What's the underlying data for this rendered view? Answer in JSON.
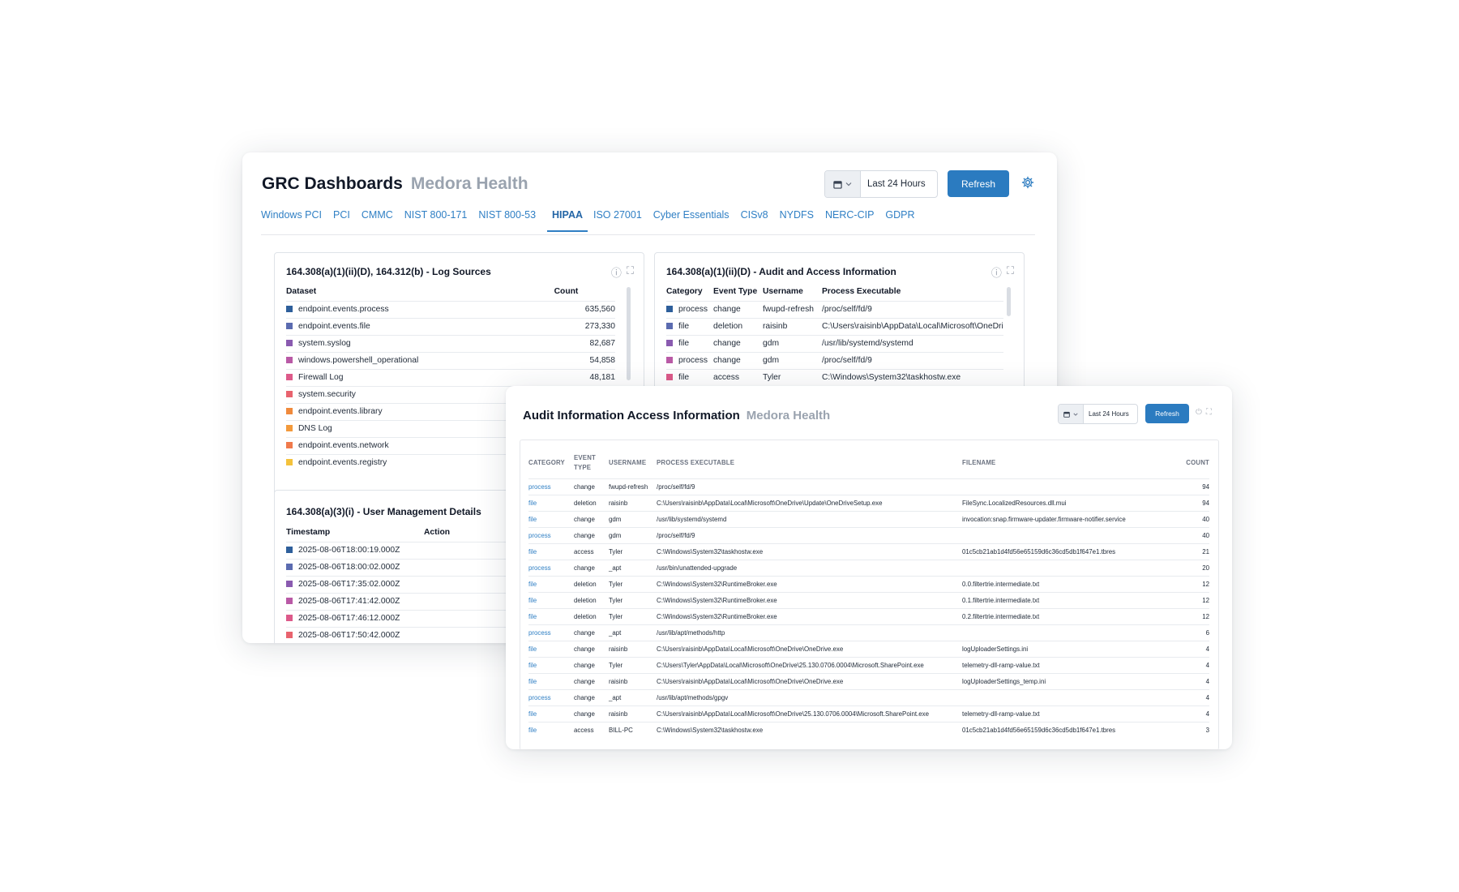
{
  "dashboard": {
    "title": "GRC Dashboards",
    "org": "Medora Health",
    "date_range": "Last 24 Hours",
    "refresh_label": "Refresh",
    "tabs": [
      "Windows PCI",
      "PCI",
      "CMMC",
      "NIST 800-171",
      "NIST 800-53",
      "HIPAA",
      "ISO 27001",
      "Cyber Essentials",
      "CISv8",
      "NYDFS",
      "NERC-CIP",
      "GDPR"
    ],
    "active_tab": "HIPAA",
    "panels": {
      "log_sources": {
        "title": "164.308(a)(1)(ii)(D), 164.312(b) - Log Sources",
        "headers": [
          "Dataset",
          "Count"
        ],
        "rows": [
          {
            "dataset": "endpoint.events.process",
            "count": "635,560",
            "color": "#2e5f9b"
          },
          {
            "dataset": "endpoint.events.file",
            "count": "273,330",
            "color": "#5b6bb0"
          },
          {
            "dataset": "system.syslog",
            "count": "82,687",
            "color": "#8a5bb0"
          },
          {
            "dataset": "windows.powershell_operational",
            "count": "54,858",
            "color": "#b95aa6"
          },
          {
            "dataset": "Firewall Log",
            "count": "48,181",
            "color": "#dd5a8a"
          },
          {
            "dataset": "system.security",
            "count": "",
            "color": "#e8636e"
          },
          {
            "dataset": "endpoint.events.library",
            "count": "",
            "color": "#f08a3c"
          },
          {
            "dataset": "DNS Log",
            "count": "",
            "color": "#f39a3c"
          },
          {
            "dataset": "endpoint.events.network",
            "count": "",
            "color": "#f07a4c"
          },
          {
            "dataset": "endpoint.events.registry",
            "count": "",
            "color": "#f4c23c"
          }
        ]
      },
      "audit_access": {
        "title": "164.308(a)(1)(ii)(D) - Audit and Access Information",
        "headers": [
          "Category",
          "Event Type",
          "Username",
          "Process Executable"
        ],
        "rows": [
          {
            "category": "process",
            "event_type": "change",
            "username": "fwupd-refresh",
            "process": "/proc/self/fd/9",
            "color": "#2e5f9b"
          },
          {
            "category": "file",
            "event_type": "deletion",
            "username": "raisinb",
            "process": "C:\\Users\\raisinb\\AppData\\Local\\Microsoft\\OneDri",
            "color": "#5b6bb0"
          },
          {
            "category": "file",
            "event_type": "change",
            "username": "gdm",
            "process": "/usr/lib/systemd/systemd",
            "color": "#8a5bb0"
          },
          {
            "category": "process",
            "event_type": "change",
            "username": "gdm",
            "process": "/proc/self/fd/9",
            "color": "#b95aa6"
          },
          {
            "category": "file",
            "event_type": "access",
            "username": "Tyler",
            "process": "C:\\Windows\\System32\\taskhostw.exe",
            "color": "#dd5a8a"
          }
        ]
      },
      "user_mgmt": {
        "title": "164.308(a)(3)(i) - User Management Details",
        "headers": [
          "Timestamp",
          "Action"
        ],
        "rows": [
          {
            "timestamp": "2025-08-06T18:00:19.000Z",
            "color": "#2e5f9b"
          },
          {
            "timestamp": "2025-08-06T18:00:02.000Z",
            "color": "#5b6bb0"
          },
          {
            "timestamp": "2025-08-06T17:35:02.000Z",
            "color": "#8a5bb0"
          },
          {
            "timestamp": "2025-08-06T17:41:42.000Z",
            "color": "#b95aa6"
          },
          {
            "timestamp": "2025-08-06T17:46:12.000Z",
            "color": "#dd5a8a"
          },
          {
            "timestamp": "2025-08-06T17:50:42.000Z",
            "color": "#e8636e"
          }
        ]
      }
    }
  },
  "detail": {
    "title": "Audit Information Access Information",
    "org": "Medora Health",
    "date_range": "Last 24 Hours",
    "refresh_label": "Refresh",
    "headers": [
      "CATEGORY",
      "EVENT TYPE",
      "USERNAME",
      "PROCESS EXECUTABLE",
      "FILENAME",
      "COUNT"
    ],
    "rows": [
      {
        "category": "process",
        "event_type": "change",
        "username": "fwupd-refresh",
        "process": "/proc/self/fd/9",
        "filename": "",
        "count": "94"
      },
      {
        "category": "file",
        "event_type": "deletion",
        "username": "raisinb",
        "process": "C:\\Users\\raisinb\\AppData\\Local\\Microsoft\\OneDrive\\Update\\OneDriveSetup.exe",
        "filename": "FileSync.LocalizedResources.dll.mui",
        "count": "94"
      },
      {
        "category": "file",
        "event_type": "change",
        "username": "gdm",
        "process": "/usr/lib/systemd/systemd",
        "filename": "invocation:snap.firmware-updater.firmware-notifier.service",
        "count": "40"
      },
      {
        "category": "process",
        "event_type": "change",
        "username": "gdm",
        "process": "/proc/self/fd/9",
        "filename": "",
        "count": "40"
      },
      {
        "category": "file",
        "event_type": "access",
        "username": "Tyler",
        "process": "C:\\Windows\\System32\\taskhostw.exe",
        "filename": "01c5cb21ab1d4fd56e65159d6c36cd5db1f647e1.tbres",
        "count": "21"
      },
      {
        "category": "process",
        "event_type": "change",
        "username": "_apt",
        "process": "/usr/bin/unattended-upgrade",
        "filename": "",
        "count": "20"
      },
      {
        "category": "file",
        "event_type": "deletion",
        "username": "Tyler",
        "process": "C:\\Windows\\System32\\RuntimeBroker.exe",
        "filename": "0.0.filtertrie.intermediate.txt",
        "count": "12"
      },
      {
        "category": "file",
        "event_type": "deletion",
        "username": "Tyler",
        "process": "C:\\Windows\\System32\\RuntimeBroker.exe",
        "filename": "0.1.filtertrie.intermediate.txt",
        "count": "12"
      },
      {
        "category": "file",
        "event_type": "deletion",
        "username": "Tyler",
        "process": "C:\\Windows\\System32\\RuntimeBroker.exe",
        "filename": "0.2.filtertrie.intermediate.txt",
        "count": "12"
      },
      {
        "category": "process",
        "event_type": "change",
        "username": "_apt",
        "process": "/usr/lib/apt/methods/http",
        "filename": "",
        "count": "6"
      },
      {
        "category": "file",
        "event_type": "change",
        "username": "raisinb",
        "process": "C:\\Users\\raisinb\\AppData\\Local\\Microsoft\\OneDrive\\OneDrive.exe",
        "filename": "logUploaderSettings.ini",
        "count": "4"
      },
      {
        "category": "file",
        "event_type": "change",
        "username": "Tyler",
        "process": "C:\\Users\\Tyler\\AppData\\Local\\Microsoft\\OneDrive\\25.130.0706.0004\\Microsoft.SharePoint.exe",
        "filename": "telemetry-dll-ramp-value.txt",
        "count": "4"
      },
      {
        "category": "file",
        "event_type": "change",
        "username": "raisinb",
        "process": "C:\\Users\\raisinb\\AppData\\Local\\Microsoft\\OneDrive\\OneDrive.exe",
        "filename": "logUploaderSettings_temp.ini",
        "count": "4"
      },
      {
        "category": "process",
        "event_type": "change",
        "username": "_apt",
        "process": "/usr/lib/apt/methods/gpgv",
        "filename": "",
        "count": "4"
      },
      {
        "category": "file",
        "event_type": "change",
        "username": "raisinb",
        "process": "C:\\Users\\raisinb\\AppData\\Local\\Microsoft\\OneDrive\\25.130.0706.0004\\Microsoft.SharePoint.exe",
        "filename": "telemetry-dll-ramp-value.txt",
        "count": "4"
      },
      {
        "category": "file",
        "event_type": "access",
        "username": "BILL-PC",
        "process": "C:\\Windows\\System32\\taskhostw.exe",
        "filename": "01c5cb21ab1d4fd56e65159d6c36cd5db1f647e1.tbres",
        "count": "3"
      }
    ]
  }
}
